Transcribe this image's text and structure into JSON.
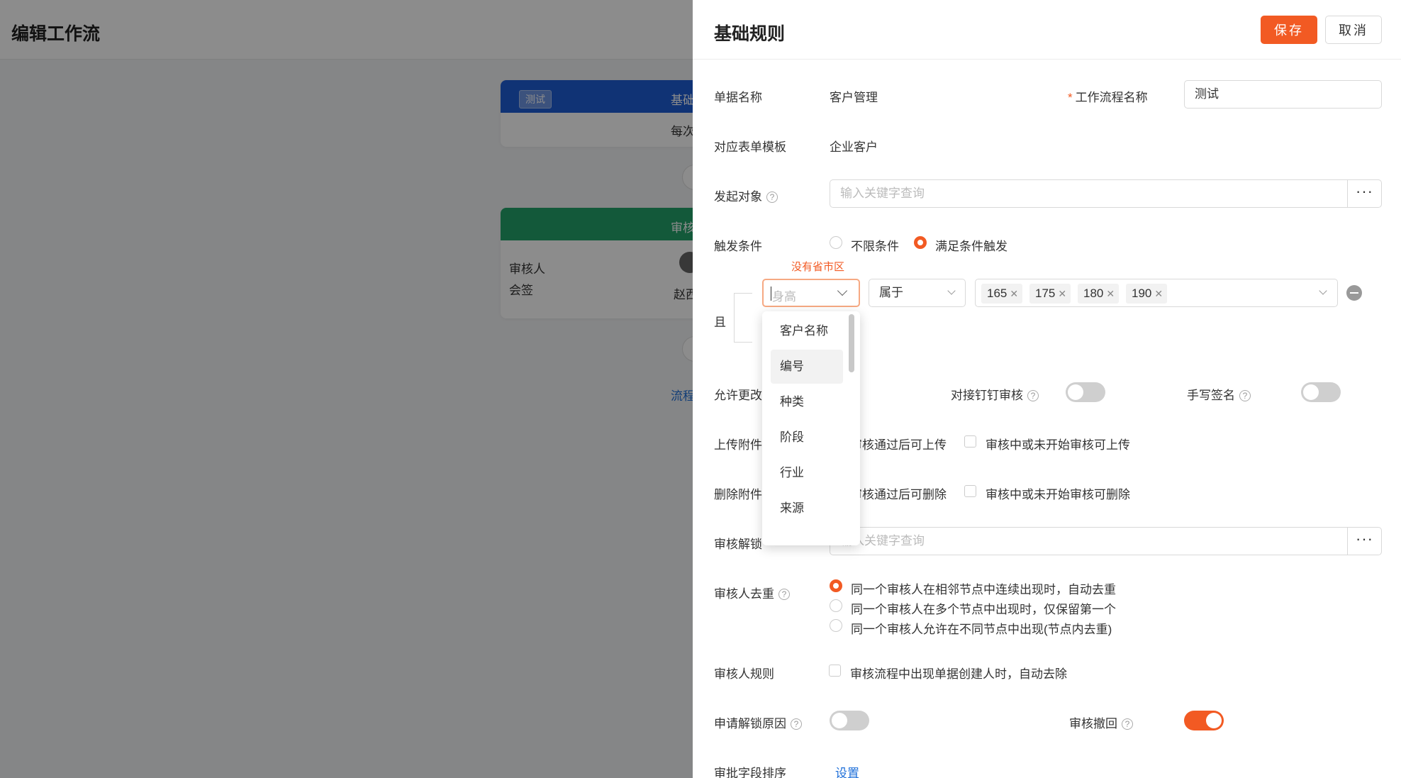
{
  "page": {
    "title": "编辑工作流"
  },
  "canvas": {
    "node1": {
      "tag": "测试",
      "title": "基础",
      "body": "每次"
    },
    "node2": {
      "title": "审核",
      "approver_label": "审核人",
      "approver_type": "会签",
      "approver_name": "赵西"
    },
    "link": "流程"
  },
  "drawer": {
    "title": "基础规则",
    "save_label": "保存",
    "cancel_label": "取消",
    "form_name_label": "单据名称",
    "form_name_value": "客户管理",
    "workflow_name_label": "工作流程名称",
    "workflow_name_value": "测试",
    "template_label": "对应表单模板",
    "template_value": "企业客户",
    "initiator_label": "发起对象",
    "initiator_placeholder": "输入关键字查询",
    "trigger_label": "触发条件",
    "trigger_options": [
      "不限条件",
      "满足条件触发"
    ],
    "trigger_selected": "满足条件触发",
    "condition": {
      "error": "没有省市区",
      "field_placeholder": "身高",
      "operator": "属于",
      "values": [
        "165",
        "175",
        "180",
        "190"
      ],
      "join": "且"
    },
    "field_dropdown": [
      "客户名称",
      "编号",
      "种类",
      "阶段",
      "行业",
      "来源"
    ],
    "allow_change_label": "允许更改",
    "dingtalk_label": "对接钉钉审核",
    "handwrite_label": "手写签名",
    "upload_label": "上传附件",
    "upload_options": [
      "审核通过后可上传",
      "审核中或未开始审核可上传"
    ],
    "delete_label": "删除附件",
    "delete_options": [
      "审核通过后可删除",
      "审核中或未开始审核可删除"
    ],
    "unlock_label": "审核解锁",
    "unlock_placeholder": "输入关键字查询",
    "dedupe_label": "审核人去重",
    "dedupe_options": [
      "同一个审核人在相邻节点中连续出现时，自动去重",
      "同一个审核人在多个节点中出现时，仅保留第一个",
      "同一个审核人允许在不同节点中出现(节点内去重)"
    ],
    "rule_label": "审核人规则",
    "rule_option": "审核流程中出现单据创建人时，自动去除",
    "unlock_reason_label": "申请解锁原因",
    "revoke_label": "审核撤回",
    "sort_label": "审批字段排序",
    "sort_link": "设置",
    "accent": "#f25a23"
  }
}
